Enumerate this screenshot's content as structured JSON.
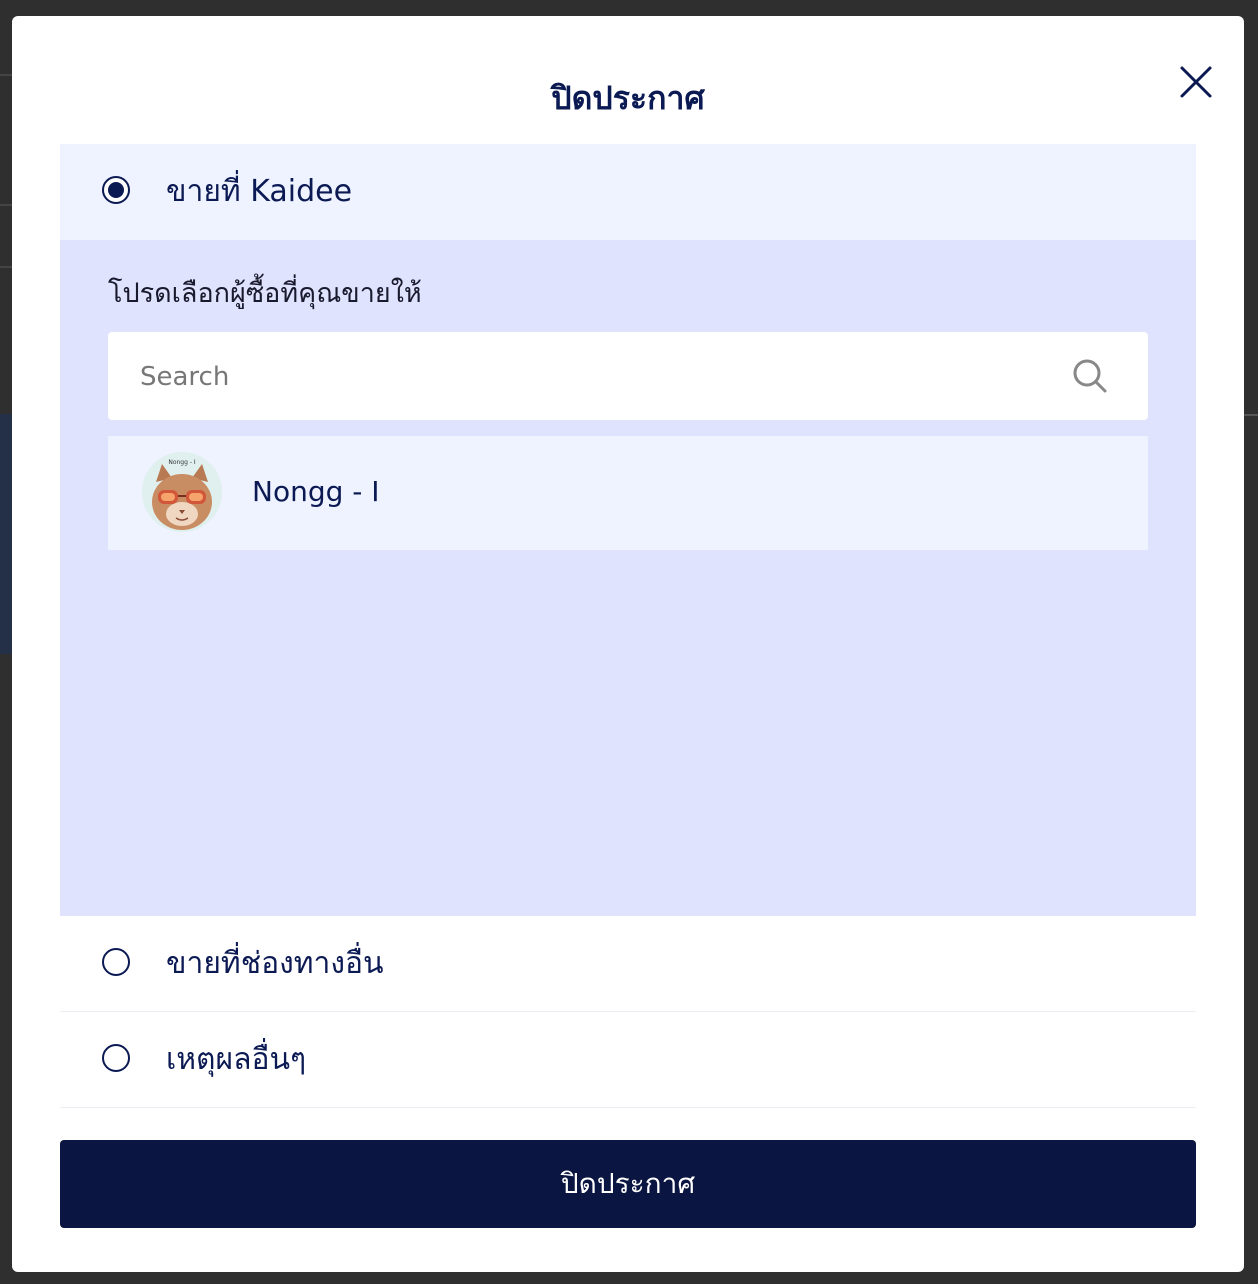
{
  "modal": {
    "title": "ปิดประกาศ",
    "close_icon": "close-icon",
    "options": [
      {
        "label": "ขายที่ Kaidee",
        "selected": true
      },
      {
        "label": "ขายที่ช่องทางอื่น",
        "selected": false
      },
      {
        "label": "เหตุผลอื่นๆ",
        "selected": false
      }
    ],
    "panel": {
      "hint": "โปรดเลือกผู้ซื้อที่คุณขายให้",
      "search": {
        "placeholder": "Search",
        "value": "",
        "icon": "search-icon"
      },
      "buyers": [
        {
          "name": "Nongg - I",
          "avatar_caption": "Nongg - I"
        }
      ]
    },
    "submit_label": "ปิดประกาศ"
  },
  "colors": {
    "primary": "#0c1a54",
    "button_bg": "#0b1542",
    "selected_option_bg": "#eff2ff",
    "panel_bg": "#dfe3fd"
  }
}
